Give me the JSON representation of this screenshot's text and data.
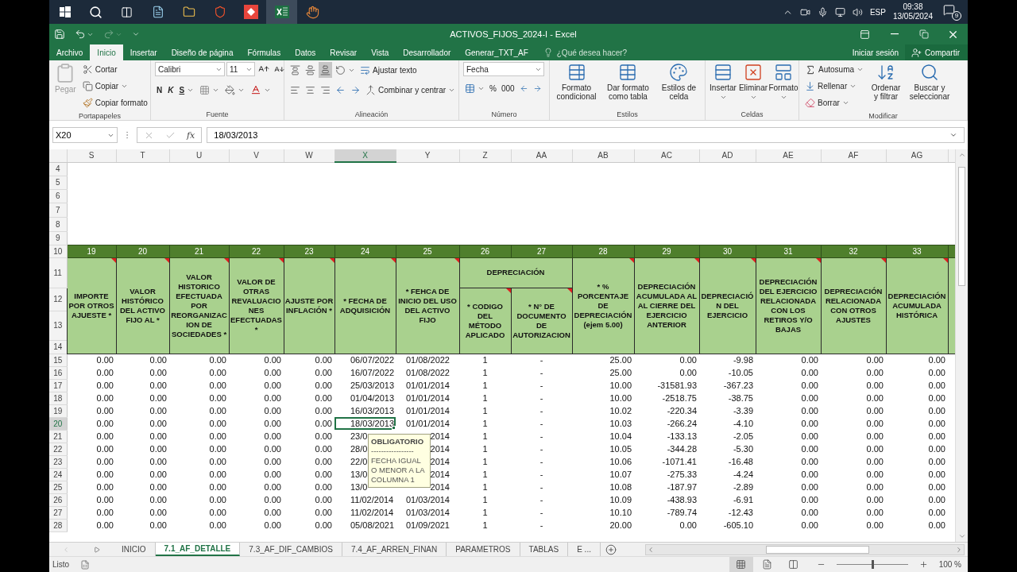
{
  "taskbar": {
    "language": "ESP",
    "time": "09:38",
    "date": "13/05/2024",
    "notification_count": "9"
  },
  "window": {
    "title": "ACTIVOS_FIJOS_2024-I - Excel",
    "redo_disabled": true
  },
  "ribbon_tabs": [
    {
      "label": "Archivo",
      "selected": false
    },
    {
      "label": "Inicio",
      "selected": true
    },
    {
      "label": "Insertar",
      "selected": false
    },
    {
      "label": "Diseño de página",
      "selected": false
    },
    {
      "label": "Fórmulas",
      "selected": false
    },
    {
      "label": "Datos",
      "selected": false
    },
    {
      "label": "Revisar",
      "selected": false
    },
    {
      "label": "Vista",
      "selected": false
    },
    {
      "label": "Desarrollador",
      "selected": false
    },
    {
      "label": "Generar_TXT_AF",
      "selected": false
    }
  ],
  "tell_me": {
    "placeholder": "¿Qué desea hacer?"
  },
  "account": {
    "sign_in": "Iniciar sesión",
    "share": "Compartir"
  },
  "ribbon": {
    "clipboard": {
      "label": "Portapapeles",
      "paste": {
        "label": "Pegar",
        "disabled": true
      },
      "cut": "Cortar",
      "copy": "Copiar",
      "format_painter": "Copiar formato"
    },
    "font": {
      "label": "Fuente",
      "font_name": "Calibri",
      "font_size": "11",
      "bold": "N",
      "italic": "K",
      "underline": "S"
    },
    "alignment": {
      "label": "Alineación",
      "wrap_text": "Ajustar texto",
      "merge_center": "Combinar y centrar"
    },
    "number": {
      "label": "Número",
      "format": "Fecha",
      "percent": "%",
      "thousands": "000"
    },
    "styles": {
      "label": "Estilos",
      "buttons": [
        "Formato condicional",
        "Dar formato como tabla",
        "Estilos de celda"
      ]
    },
    "cells": {
      "label": "Celdas",
      "buttons": [
        "Insertar",
        "Eliminar",
        "Formato"
      ]
    },
    "editing": {
      "label": "Modificar",
      "autosum": "Autosuma",
      "fill": "Rellenar",
      "clear": "Borrar",
      "sort_filter": "Ordenar y filtrar",
      "find_select": "Buscar y seleccionar"
    }
  },
  "formula_bar": {
    "name_box": "X20",
    "function_label": "fx",
    "value": "18/03/2013"
  },
  "sheet": {
    "columns": [
      {
        "label": "S",
        "selected": false
      },
      {
        "label": "T",
        "selected": false
      },
      {
        "label": "U",
        "selected": false
      },
      {
        "label": "V",
        "selected": false
      },
      {
        "label": "W",
        "selected": false
      },
      {
        "label": "X",
        "selected": true
      },
      {
        "label": "Y",
        "selected": false
      },
      {
        "label": "Z",
        "selected": false
      },
      {
        "label": "AA",
        "selected": false
      },
      {
        "label": "AB",
        "selected": false
      },
      {
        "label": "AC",
        "selected": false
      },
      {
        "label": "AD",
        "selected": false
      },
      {
        "label": "AE",
        "selected": false
      },
      {
        "label": "AF",
        "selected": false
      },
      {
        "label": "AG",
        "selected": false
      }
    ],
    "empty_rows": [
      "4",
      "5",
      "6",
      "7",
      "8",
      "9"
    ],
    "field_number_row": {
      "num": "10",
      "numbers": [
        "19",
        "20",
        "21",
        "22",
        "23",
        "24",
        "25",
        "26",
        "27",
        "28",
        "29",
        "30",
        "31",
        "32",
        "33"
      ]
    },
    "header_rows": [
      "11",
      "12",
      "13",
      "14"
    ],
    "field_headers": [
      {
        "kind": "single",
        "text": "IMPORTE POR OTROS AJUESTE *",
        "comment": true
      },
      {
        "kind": "single",
        "text": "VALOR HISTÓRICO DEL ACTIVO FIJO AL *",
        "comment": true
      },
      {
        "kind": "single",
        "text": "VALOR HISTORICO EFECTUADA POR REORGANIZACION DE SOCIEDADES *",
        "comment": true
      },
      {
        "kind": "single",
        "text": "VALOR DE OTRAS REVALUACIONES EFECTUADAS *",
        "comment": true
      },
      {
        "kind": "single",
        "text": "AJUSTE POR INFLACIÓN *",
        "comment": true
      },
      {
        "kind": "single",
        "text": "* FECHA DE ADQUISICIÓN",
        "comment": true
      },
      {
        "kind": "single",
        "text": "* FEHCA DE INICIO DEL USO DEL ACTIVO FIJO",
        "comment": true
      },
      {
        "kind": "group",
        "label": "DEPRECIACIÓN",
        "children": [
          {
            "text": "* CODIGO DEL MÉTODO APLICADO",
            "comment": true
          },
          {
            "text": "* N° DE DOCUMENTO DE AUTORIZACION",
            "comment": true
          }
        ]
      },
      {
        "kind": "single",
        "text": "* % PORCENTAJE DE DEPRECIACIÓN (ejem 5.00)",
        "comment": true
      },
      {
        "kind": "single",
        "text": "DEPRECIACIÓN ACUMULADA AL AL CIERRE DEL EJERCICIO ANTERIOR",
        "comment": true
      },
      {
        "kind": "single",
        "text": "DEPRECIACIÓN DEL EJERCICIO",
        "comment": true
      },
      {
        "kind": "single",
        "text": "DEPRECIACIÓN DEL EJERCICIO RELACIONADA CON LOS RETIROS Y/O BAJAS",
        "comment": true
      },
      {
        "kind": "single",
        "text": "DEPRECIACIÓN RELACIONADA CON OTROS AJUSTES",
        "comment": true
      },
      {
        "kind": "single",
        "text": "DEPRECIACIÓN ACUMULADA HISTÓRICA",
        "comment": true
      }
    ],
    "data_rows": [
      {
        "num": "15",
        "selected": false,
        "cells": [
          "0.00",
          "0.00",
          "0.00",
          "0.00",
          "0.00",
          "06/07/2022",
          "01/08/2022",
          "1",
          "-",
          "25.00",
          "0.00",
          "-9.98",
          "0.00",
          "0.00",
          "0.00"
        ]
      },
      {
        "num": "16",
        "selected": false,
        "cells": [
          "0.00",
          "0.00",
          "0.00",
          "0.00",
          "0.00",
          "16/07/2022",
          "01/08/2022",
          "1",
          "-",
          "25.00",
          "0.00",
          "-10.05",
          "0.00",
          "0.00",
          "0.00"
        ]
      },
      {
        "num": "17",
        "selected": false,
        "cells": [
          "0.00",
          "0.00",
          "0.00",
          "0.00",
          "0.00",
          "25/03/2013",
          "01/01/2014",
          "1",
          "-",
          "10.00",
          "-31581.93",
          "-367.23",
          "0.00",
          "0.00",
          "0.00"
        ]
      },
      {
        "num": "18",
        "selected": false,
        "cells": [
          "0.00",
          "0.00",
          "0.00",
          "0.00",
          "0.00",
          "01/04/2013",
          "01/01/2014",
          "1",
          "-",
          "10.00",
          "-2518.75",
          "-38.75",
          "0.00",
          "0.00",
          "0.00"
        ]
      },
      {
        "num": "19",
        "selected": false,
        "cells": [
          "0.00",
          "0.00",
          "0.00",
          "0.00",
          "0.00",
          "16/03/2013",
          "01/01/2014",
          "1",
          "-",
          "10.02",
          "-220.34",
          "-3.39",
          "0.00",
          "0.00",
          "0.00"
        ]
      },
      {
        "num": "20",
        "selected": true,
        "cells": [
          "0.00",
          "0.00",
          "0.00",
          "0.00",
          "0.00",
          "18/03/2013",
          "01/01/2014",
          "1",
          "-",
          "10.03",
          "-266.24",
          "-4.10",
          "0.00",
          "0.00",
          "0.00"
        ]
      },
      {
        "num": "21",
        "selected": false,
        "cells": [
          "0.00",
          "0.00",
          "0.00",
          "0.00",
          "0.00",
          "23/0",
          "2014",
          "1",
          "-",
          "10.04",
          "-133.13",
          "-2.05",
          "0.00",
          "0.00",
          "0.00"
        ]
      },
      {
        "num": "22",
        "selected": false,
        "cells": [
          "0.00",
          "0.00",
          "0.00",
          "0.00",
          "0.00",
          "28/0",
          "2014",
          "1",
          "-",
          "10.05",
          "-344.28",
          "-5.30",
          "0.00",
          "0.00",
          "0.00"
        ]
      },
      {
        "num": "23",
        "selected": false,
        "cells": [
          "0.00",
          "0.00",
          "0.00",
          "0.00",
          "0.00",
          "22/0",
          "2014",
          "1",
          "-",
          "10.06",
          "-1071.41",
          "-16.48",
          "0.00",
          "0.00",
          "0.00"
        ]
      },
      {
        "num": "24",
        "selected": false,
        "cells": [
          "0.00",
          "0.00",
          "0.00",
          "0.00",
          "0.00",
          "13/0",
          "2014",
          "1",
          "-",
          "10.07",
          "-275.33",
          "-4.24",
          "0.00",
          "0.00",
          "0.00"
        ]
      },
      {
        "num": "25",
        "selected": false,
        "cells": [
          "0.00",
          "0.00",
          "0.00",
          "0.00",
          "0.00",
          "13/0",
          "2014",
          "1",
          "-",
          "10.08",
          "-187.97",
          "-2.89",
          "0.00",
          "0.00",
          "0.00"
        ]
      },
      {
        "num": "26",
        "selected": false,
        "cells": [
          "0.00",
          "0.00",
          "0.00",
          "0.00",
          "0.00",
          "11/02/2014",
          "01/03/2014",
          "1",
          "-",
          "10.09",
          "-438.93",
          "-6.91",
          "0.00",
          "0.00",
          "0.00"
        ]
      },
      {
        "num": "27",
        "selected": false,
        "cells": [
          "0.00",
          "0.00",
          "0.00",
          "0.00",
          "0.00",
          "11/02/2014",
          "01/03/2014",
          "1",
          "-",
          "10.10",
          "-789.74",
          "-12.43",
          "0.00",
          "0.00",
          "0.00"
        ]
      },
      {
        "num": "28",
        "selected": false,
        "cells": [
          "0.00",
          "0.00",
          "0.00",
          "0.00",
          "0.00",
          "05/08/2021",
          "01/09/2021",
          "1",
          "-",
          "20.00",
          "0.00",
          "-605.10",
          "0.00",
          "0.00",
          "0.00"
        ]
      }
    ],
    "tooltip": {
      "title": "OBLIGATORIO",
      "separator": "-----------------",
      "text": "FECHA IGUAL O MENOR A LA COLUMNA 1"
    }
  },
  "sheet_tabs": [
    {
      "label": "INICIO",
      "selected": false
    },
    {
      "label": "7.1_AF_DETALLE",
      "selected": true
    },
    {
      "label": "7.3_AF_DIF_CAMBIOS",
      "selected": false
    },
    {
      "label": "7.4_AF_ARREN_FINAN",
      "selected": false
    },
    {
      "label": "PARAMETROS",
      "selected": false
    },
    {
      "label": "TABLAS",
      "selected": false
    },
    {
      "label": "E ...",
      "selected": false
    }
  ],
  "status_bar": {
    "text": "Listo",
    "zoom": "100 %",
    "level": 0.5
  }
}
